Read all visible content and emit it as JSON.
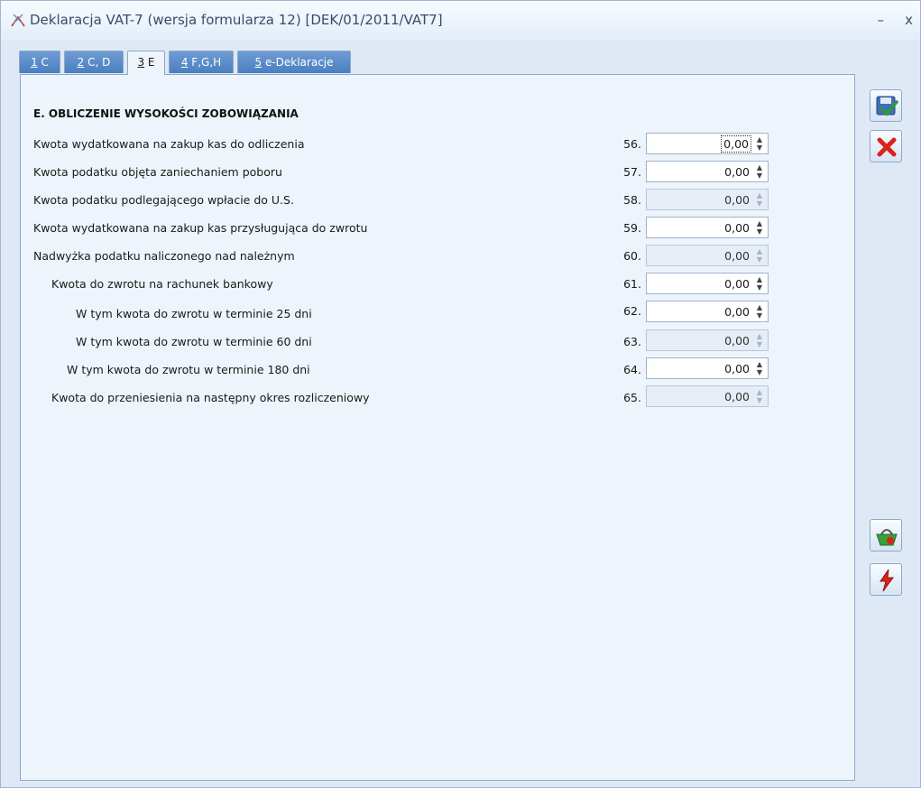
{
  "window": {
    "title": "Deklaracja VAT-7 (wersja formularza 12) [DEK/01/2011/VAT7]",
    "minimize": "–",
    "close": "x"
  },
  "tabs": [
    {
      "key": "1",
      "label": " C",
      "active": false
    },
    {
      "key": "2",
      "label": " C, D",
      "active": false
    },
    {
      "key": "3",
      "label": " E",
      "active": true
    },
    {
      "key": "4",
      "label": " F,G,H",
      "active": false
    },
    {
      "key": "5",
      "label": " e-Deklaracje",
      "active": false
    }
  ],
  "section": {
    "heading": "E. OBLICZENIE WYSOKOŚCI ZOBOWIĄZANIA",
    "rows": [
      {
        "label": "Kwota wydatkowana na zakup kas do odliczenia",
        "num": "56.",
        "value": "0,00",
        "editable": true,
        "focused": true
      },
      {
        "label": "Kwota podatku objęta zaniechaniem poboru",
        "num": "57.",
        "value": "0,00",
        "editable": true
      },
      {
        "label": "Kwota podatku podlegającego wpłacie do U.S.",
        "num": "58.",
        "value": "0,00",
        "editable": false
      },
      {
        "label": "Kwota wydatkowana na zakup kas przysługująca do zwrotu",
        "num": "59.",
        "value": "0,00",
        "editable": true
      },
      {
        "label": "Nadwyżka podatku naliczonego nad należnym",
        "num": "60.",
        "value": "0,00",
        "editable": false
      },
      {
        "label": "Kwota do zwrotu na rachunek bankowy",
        "num": "61.",
        "value": "0,00",
        "editable": true
      },
      {
        "label": "W tym kwota do zwrotu w terminie 25 dni",
        "num": "62.",
        "value": "0,00",
        "editable": true
      },
      {
        "label": "W tym kwota do zwrotu w terminie 60 dni",
        "num": "63.",
        "value": "0,00",
        "editable": false
      },
      {
        "label": "W tym kwota do zwrotu w terminie 180 dni",
        "num": "64.",
        "value": "0,00",
        "editable": true
      },
      {
        "label": "Kwota do przeniesienia na następny okres rozliczeniowy",
        "num": "65.",
        "value": "0,00",
        "editable": false
      }
    ]
  },
  "side_buttons": {
    "save_icon": "save-check-icon",
    "cancel_icon": "red-x-icon",
    "basket_icon": "basket-icon",
    "lightning_icon": "lightning-icon"
  },
  "colors": {
    "tab_inactive": "#4a7fc1",
    "panel": "#eef4fb",
    "accent_red": "#d9231c",
    "accent_green": "#3aa03a"
  }
}
